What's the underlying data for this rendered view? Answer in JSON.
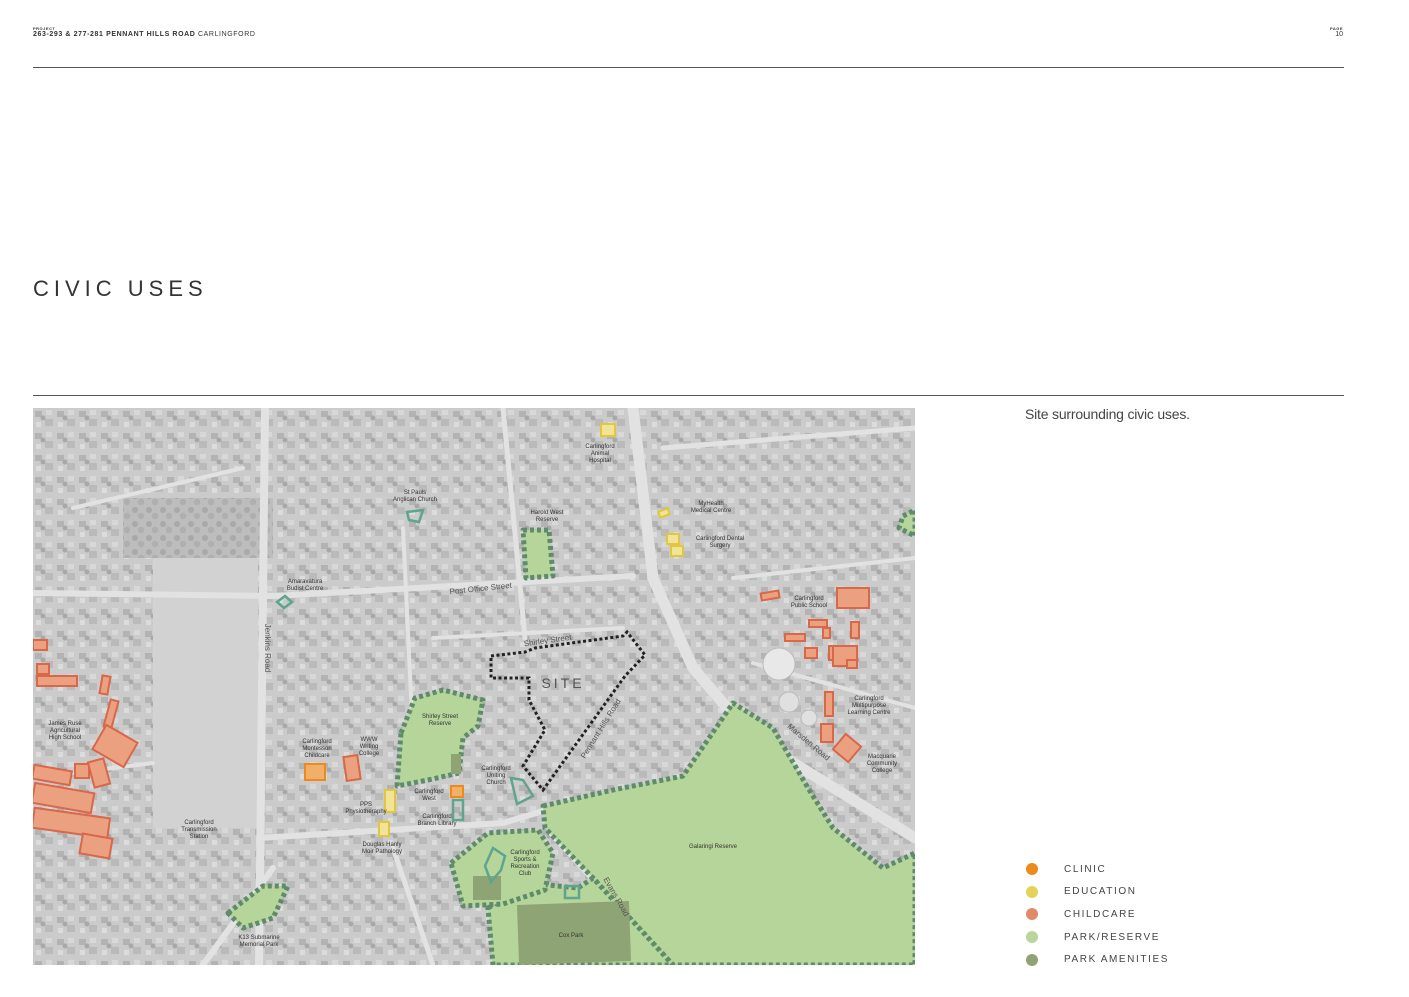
{
  "header": {
    "project_label": "PROJECT",
    "project_bold": "263-293 & 277-281 PENNANT HILLS ROAD",
    "project_suburb": "CARLINGFORD",
    "page_label": "PAGE",
    "page_number": "10"
  },
  "title": "CIVIC USES",
  "caption": "Site surrounding civic uses.",
  "legend": [
    {
      "label": "CLINIC",
      "color": "#ec8a1e"
    },
    {
      "label": "EDUCATION",
      "color": "#e6d25a"
    },
    {
      "label": "CHILDCARE",
      "color": "#e08a6a"
    },
    {
      "label": "PARK/RESERVE",
      "color": "#b9d79a"
    },
    {
      "label": "PARK AMENITIES",
      "color": "#8fa474"
    }
  ],
  "map": {
    "site_label": "SITE",
    "places": {
      "animal_hospital": [
        "Carlingford",
        "Animal",
        "Hospital"
      ],
      "st_pauls": [
        "St Pauls",
        "Anglican Church"
      ],
      "harold_west": [
        "Harold West",
        "Reserve"
      ],
      "myhealth": [
        "MyHealth",
        "Medical Centre"
      ],
      "dental": [
        "Carlingford Dental",
        "Surgery"
      ],
      "amaravatura": [
        "Amaravatura",
        "Budist Centre"
      ],
      "public_school": [
        "Carlingford",
        "Public School"
      ],
      "james_ruse": [
        "James Ruse",
        "Agricultural",
        "High School"
      ],
      "montessori": [
        "Carlingford",
        "Montessori",
        "Childcare"
      ],
      "www_writing": [
        "WWW",
        "Writing",
        "College"
      ],
      "shirley_street": [
        "Shirley Street",
        "Reserve"
      ],
      "uniting_church": [
        "Carlingford",
        "Uniting",
        "Church"
      ],
      "multipurpose": [
        "Carlingford",
        "Multipurpose",
        "Learning Centre"
      ],
      "macquarie": [
        "Macquarie",
        "Community",
        "College"
      ],
      "transmission": [
        "Carlingford",
        "Transmission",
        "Station"
      ],
      "pps": [
        "PPS",
        "Physiotheraphy"
      ],
      "carlingford_west": [
        "Carlingford",
        "West"
      ],
      "branch_library": [
        "Carlingford",
        "Branch Library"
      ],
      "douglas_hanly": [
        "Douglas Hanly",
        "Moir Pathology"
      ],
      "sports_club": [
        "Carlingford",
        "Sports &",
        "Recreation",
        "Club"
      ],
      "galaringi": [
        "Galaringi Reserve"
      ],
      "k13": [
        "K13 Submarine",
        "Memorial Park"
      ],
      "cox_park": [
        "Cox Park"
      ]
    },
    "roads": {
      "jenkins": "Jenkins Road",
      "post_office": "Post Office Street",
      "shirley": "Shirley Street",
      "pennant_hills": "Pennant Hills Road",
      "marsden": "Marsden Road",
      "evans": "Evans Road"
    }
  }
}
